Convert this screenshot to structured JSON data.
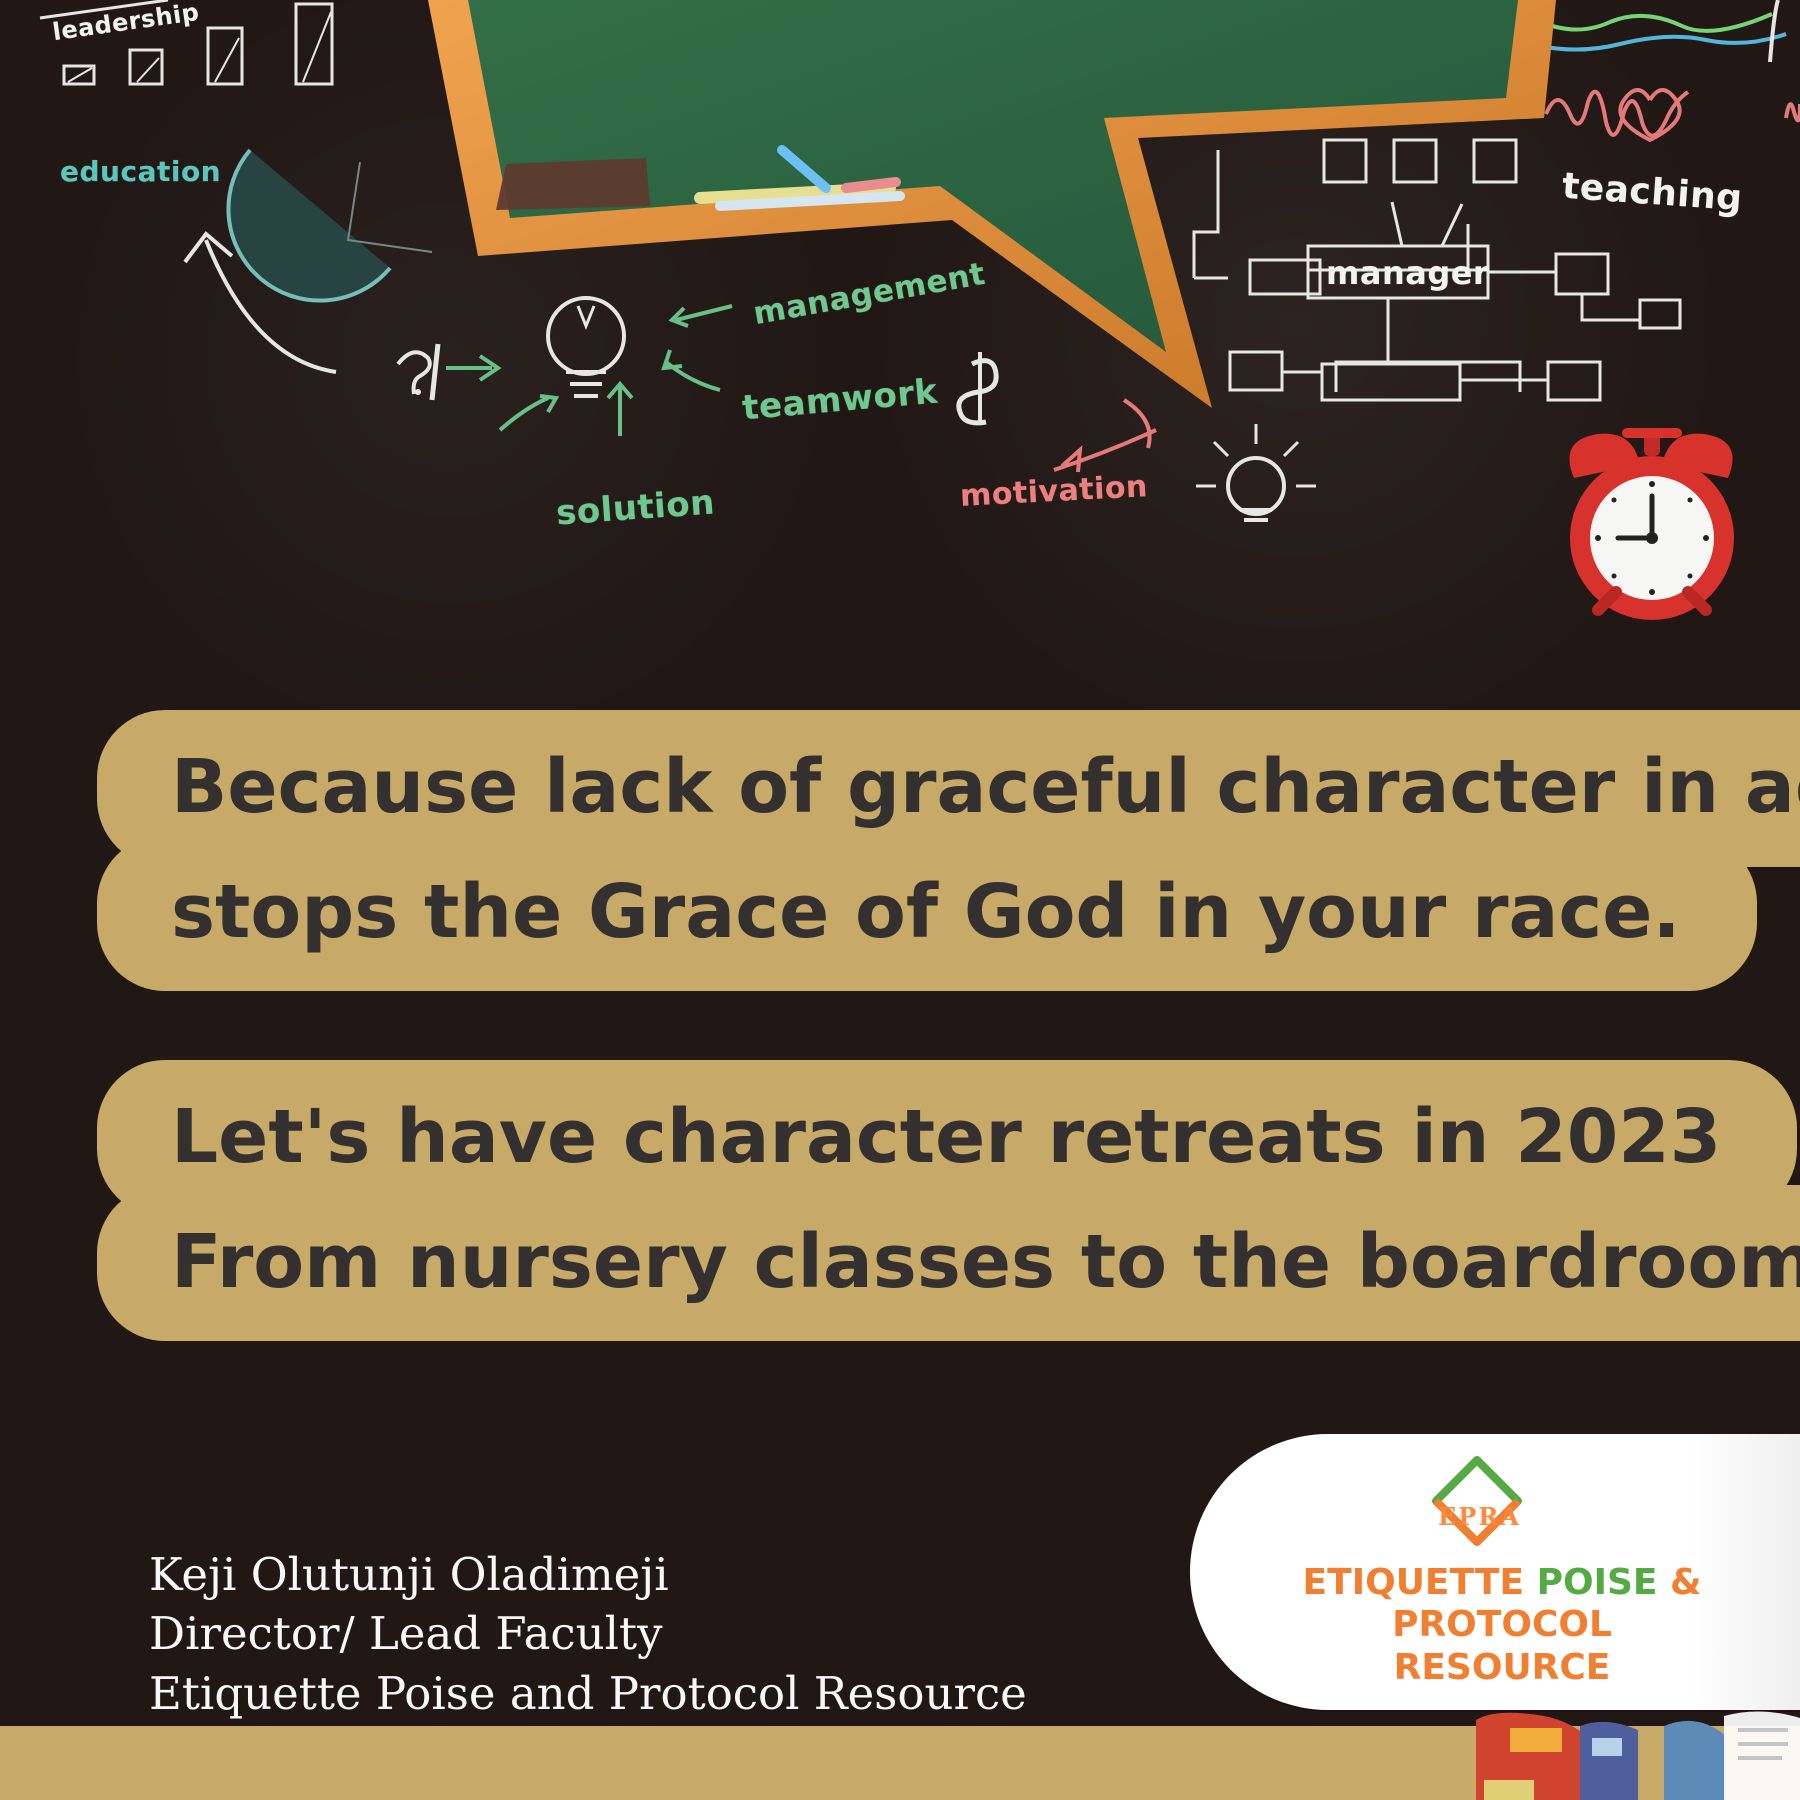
{
  "scene": {
    "labels": {
      "leadership": "leadership",
      "education": "education",
      "management": "management",
      "teamwork": "teamwork",
      "solution": "solution",
      "motivation": "motivation",
      "teaching": "teaching",
      "manager": "manager"
    },
    "colors": {
      "background": "#211816",
      "board_green": "#2f6a45",
      "board_frame": "#d88b35",
      "quote_bg": "#c8aa68",
      "quote_text": "#34302f",
      "signature_text": "#f7f7f7",
      "logo_orange": "#f07f32",
      "logo_green": "#55aa43",
      "clock_red": "#d8322d"
    }
  },
  "quote": {
    "block1": {
      "line1": "Because lack of graceful character in adults,",
      "line2": "stops the Grace of God in your race."
    },
    "block2": {
      "line1": "Let's have character retreats in 2023",
      "line2": "From nursery classes to the boardroom."
    }
  },
  "signature": {
    "name": "Keji Olutunji Oladimeji",
    "title": "Director/ Lead Faculty",
    "organization": "Etiquette Poise and Protocol Resource"
  },
  "logo": {
    "mark": "EPRA",
    "name_part1": "ETIQUETTE ",
    "name_part2": "POISE",
    "name_part3": " & PROTOCOL",
    "name_line2": "RESOURCE"
  }
}
